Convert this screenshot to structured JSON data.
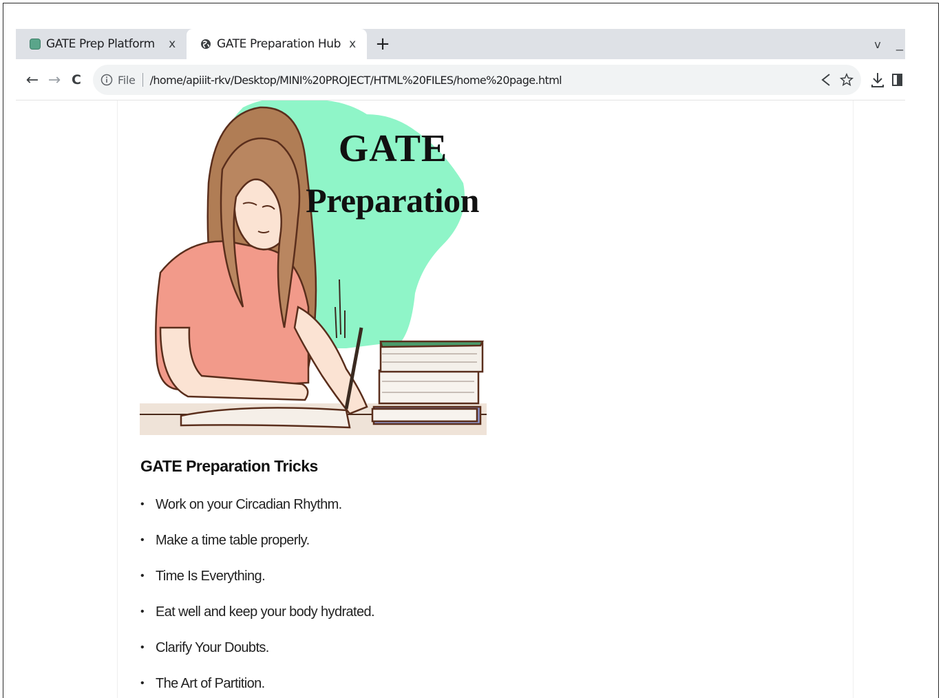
{
  "browser": {
    "tabs": [
      {
        "title": "GATE Prep Platform",
        "close": "x",
        "active": false
      },
      {
        "title": "GATE Preparation Hub",
        "close": "x",
        "active": true
      }
    ],
    "new_tab": "+",
    "tab_search": "v",
    "minimize": "_",
    "nav": {
      "back": "←",
      "forward": "→",
      "reload": "C"
    },
    "address": {
      "scheme_label": "File",
      "url": "/home/apiiit-rkv/Desktop/MINI%20PROJECT/HTML%20FILES/home%20page.html"
    },
    "toolbar_icons": [
      "share-icon",
      "star-icon",
      "download-icon",
      "side-panel-icon"
    ]
  },
  "page": {
    "hero": {
      "line1": "GATE",
      "line2": "Preparation",
      "accent_color": "#8ff5c8"
    },
    "tricks_heading": "GATE Preparation Tricks",
    "tricks": [
      "Work on your Circadian Rhythm.",
      "Make a time table properly.",
      "Time Is Everything.",
      "Eat well and keep your body hydrated.",
      "Clarify Your Doubts.",
      "The Art of Partition."
    ],
    "bullet": "•"
  }
}
